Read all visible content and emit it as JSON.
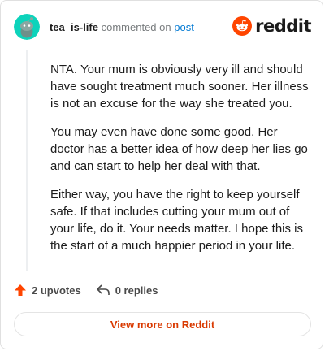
{
  "header": {
    "username": "tea_is-life",
    "commented_text": "commented on",
    "post_link": "post",
    "avatar_icon": "snoo-avatar-icon",
    "logo_icon": "reddit-snoo-icon",
    "logo_text": "reddit"
  },
  "comment": {
    "paragraphs": [
      "NTA. Your mum is obviously very ill and should have sought treatment much sooner. Her illness is not an excuse for the way she treated you.",
      "You may even have done some good. Her doctor has a better idea of how deep her lies go and can start to help her deal with that.",
      "Either way, you have the right to keep yourself safe. If that includes cutting your mum out of your life, do it. Your needs matter. I hope this is the start of a much happier period in your life."
    ]
  },
  "actions": {
    "upvotes_label": "2 upvotes",
    "replies_label": "0 replies",
    "upvote_icon": "upvote-arrow-icon",
    "reply_icon": "reply-arrow-icon"
  },
  "footer": {
    "view_more_label": "View more on Reddit"
  },
  "colors": {
    "accent": "#d93900",
    "link": "#0079d3",
    "avatar_bg": "#0dd3bb",
    "reddit_orange": "#ff4500"
  }
}
